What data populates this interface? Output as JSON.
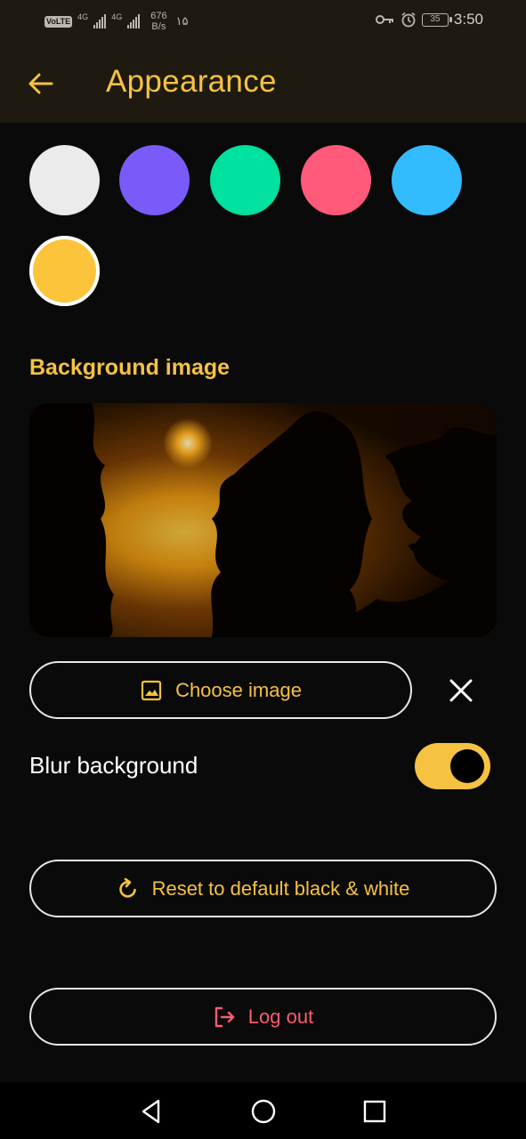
{
  "status_bar": {
    "volte": "VoLTE",
    "network_1": "4G",
    "network_2": "4G",
    "speed_value": "676",
    "speed_unit": "B/s",
    "extra_text": "۱۵",
    "battery_level": "35",
    "time": "3:50"
  },
  "app_bar": {
    "title": "Appearance",
    "back_icon": "arrow-left-icon"
  },
  "accent_colors": {
    "options": [
      "#ebebeb",
      "#7a5af8",
      "#00e09e",
      "#ff5a7a",
      "#33bbff",
      "#fcc43a"
    ],
    "selected": "#fcc43a"
  },
  "background_image": {
    "section_title": "Background image",
    "choose_label": "Choose image",
    "choose_icon": "image-icon",
    "clear_icon": "close-icon"
  },
  "blur": {
    "label": "Blur background",
    "enabled": true
  },
  "actions": {
    "reset_label": "Reset to default black & white",
    "reset_icon": "refresh-icon",
    "logout_label": "Log out",
    "logout_icon": "logout-icon"
  },
  "theme": {
    "accent": "#f5c242",
    "danger": "#ff5a6e",
    "background": "#0a0a0a",
    "bar": "#1e1a10"
  },
  "nav_bar": {
    "back_icon": "triangle-back-icon",
    "home_icon": "circle-home-icon",
    "recents_icon": "square-recents-icon"
  }
}
